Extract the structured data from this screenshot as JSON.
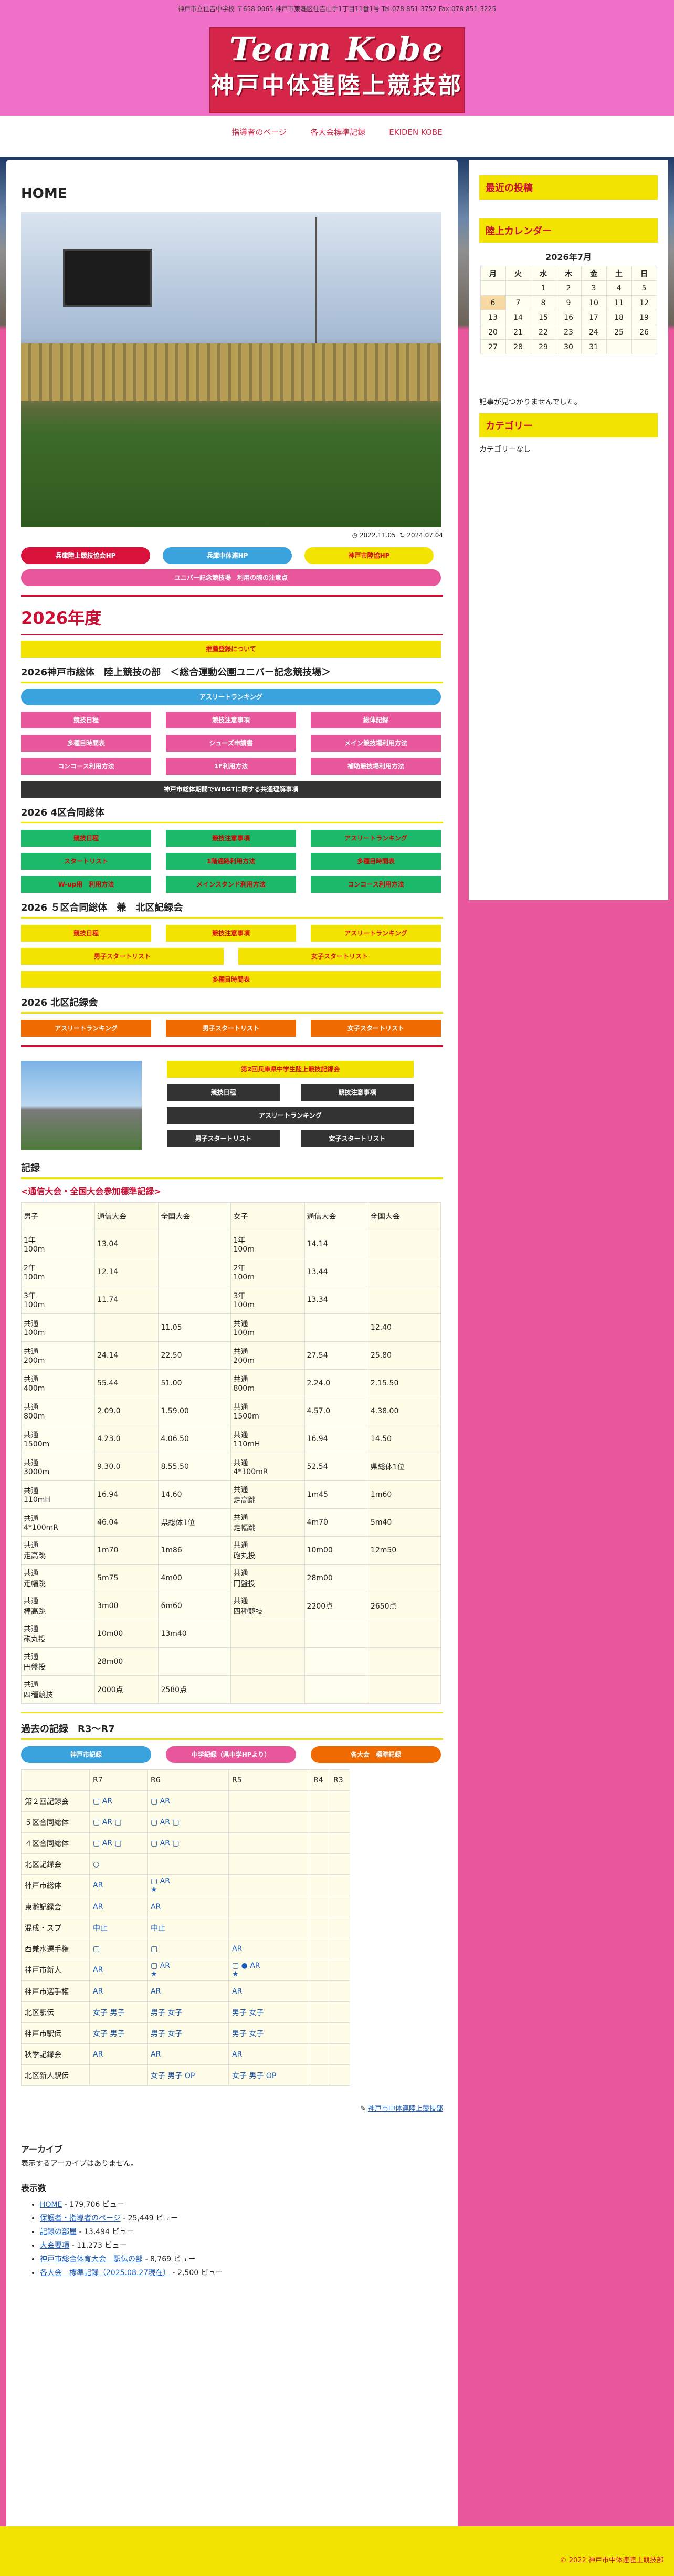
{
  "header": {
    "address": "神戸市立住吉中学校 〒658-0065 神戸市東灘区住吉山手1丁目11番1号 Tel:078-851-3752 Fax:078-851-3225",
    "logo_line1": "Team Kobe",
    "logo_line2": "神戸中体連陸上競技部"
  },
  "nav": [
    "指導者のページ",
    "各大会標準記録",
    "EKIDEN KOBE"
  ],
  "main": {
    "title": "HOME",
    "date_posted": "2022.11.05",
    "date_updated": "2024.07.04",
    "links_row1": [
      "兵庫陸上競技協会HP",
      "兵庫中体連HP",
      "神戸市陸協HP"
    ],
    "link_full": "ユニバー記念競技場　利用の際の注意点",
    "year": "2026年度",
    "yellow_bar": "推薦登録について",
    "s1_title": "2026神戸市総体　陸上競技の部　＜総合運動公園ユニバー記念競技場＞",
    "s1_full": "アスリートランキング",
    "s1_grid": [
      "競技日程",
      "競技注意事項",
      "総体記録",
      "多種目時間表",
      "シューズ申請書",
      "メイン競技場利用方法",
      "コンコース利用方法",
      "1F利用方法",
      "補助競技場利用方法"
    ],
    "s1_dark": "神戸市総体期間でWBGTに関する共通理解事項",
    "s2_title": "2026 4区合同総体",
    "s2_grid": [
      "競技日程",
      "競技注意事項",
      "アスリートランキング",
      "スタートリスト",
      "1階通路利用方法",
      "多種目時間表",
      "W-up用　利用方法",
      "メインスタンド利用方法",
      "コンコース利用方法"
    ],
    "s3_title": "2026 ５区合同総体　兼　北区記録会",
    "s3_grid": [
      "競技日程",
      "競技注意事項",
      "アスリートランキング"
    ],
    "s3_two": [
      "男子スタートリスト",
      "女子スタートリスト"
    ],
    "s3_full": "多種目時間表",
    "s4_title": "2026 北区記録会",
    "s4_grid": [
      "アスリートランキング",
      "男子スタートリスト",
      "女子スタートリスト"
    ],
    "s5_yellow": "第2回兵庫県中学生陸上競技記録会",
    "s5_btns": [
      "競技日程",
      "競技注意事項",
      "アスリートランキング",
      "男子スタートリスト",
      "女子スタートリスト"
    ],
    "rec_title": "記録",
    "rec_sub": "<通信大会・全国大会参加標準記録>",
    "rec_head": [
      "男子",
      "通信大会",
      "全国大会",
      "女子",
      "通信大会",
      "全国大会"
    ],
    "rec_rows": [
      [
        "1年\n100m",
        "13.04",
        "",
        "1年\n100m",
        "14.14",
        ""
      ],
      [
        "2年\n100m",
        "12.14",
        "",
        "2年\n100m",
        "13.44",
        ""
      ],
      [
        "3年\n100m",
        "11.74",
        "",
        "3年\n100m",
        "13.34",
        ""
      ],
      [
        "共通\n100m",
        "",
        "11.05",
        "共通\n100m",
        "",
        "12.40"
      ],
      [
        "共通\n200m",
        "24.14",
        "22.50",
        "共通\n200m",
        "27.54",
        "25.80"
      ],
      [
        "共通\n400m",
        "55.44",
        "51.00",
        "共通\n800m",
        "2.24.0",
        "2.15.50"
      ],
      [
        "共通\n800m",
        "2.09.0",
        "1.59.00",
        "共通\n1500m",
        "4.57.0",
        "4.38.00"
      ],
      [
        "共通\n1500m",
        "4.23.0",
        "4.06.50",
        "共通\n110mH",
        "16.94",
        "14.50"
      ],
      [
        "共通\n3000m",
        "9.30.0",
        "8.55.50",
        "共通\n4*100mR",
        "52.54",
        "県総体1位"
      ],
      [
        "共通\n110mH",
        "16.94",
        "14.60",
        "共通\n走高跳",
        "1m45",
        "1m60"
      ],
      [
        "共通\n4*100mR",
        "46.04",
        "県総体1位",
        "共通\n走幅跳",
        "4m70",
        "5m40"
      ],
      [
        "共通\n走高跳",
        "1m70",
        "1m86",
        "共通\n砲丸投",
        "10m00",
        "12m50"
      ],
      [
        "共通\n走幅跳",
        "5m75",
        "4m00",
        "共通\n円盤投",
        "28m00",
        ""
      ],
      [
        "共通\n棒高跳",
        "3m00",
        "6m60",
        "共通\n四種競技",
        "2200点",
        "2650点"
      ],
      [
        "共通\n砲丸投",
        "10m00",
        "13m40",
        "",
        "",
        ""
      ],
      [
        "共通\n円盤投",
        "28m00",
        "",
        "",
        "",
        ""
      ],
      [
        "共通\n四種競技",
        "2000点",
        "2580点",
        "",
        "",
        ""
      ]
    ],
    "past_title": "過去の記録　R3〜R7",
    "past_btns": [
      "神戸市記録",
      "中学記録（県中学HPより）",
      "各大会　標準記録"
    ],
    "past_head": [
      "",
      "R7",
      "R6",
      "R5",
      "R4",
      "R3"
    ],
    "past_rows": [
      [
        "第２回記録会",
        "▢ AR",
        "▢ AR",
        "",
        "",
        ""
      ],
      [
        "５区合同総体",
        "▢ AR ▢",
        "▢ AR ▢",
        "",
        "",
        ""
      ],
      [
        "４区合同総体",
        "▢ AR ▢",
        "▢ AR ▢",
        "",
        "",
        ""
      ],
      [
        "北区記録会",
        "○",
        "",
        "",
        "",
        ""
      ],
      [
        "神戸市総体",
        "AR",
        "▢ AR\n★",
        "",
        "",
        ""
      ],
      [
        "東灘記録会",
        "AR",
        "AR",
        "",
        "",
        ""
      ],
      [
        "混成・スプ",
        "中止",
        "中止",
        "",
        "",
        ""
      ],
      [
        "西兼水選手権",
        "▢",
        "▢",
        "AR",
        "",
        ""
      ],
      [
        "神戸市新人",
        "AR",
        "▢ AR\n★",
        "▢ ● AR\n★",
        "",
        ""
      ],
      [
        "神戸市選手権",
        "AR",
        "AR",
        "AR",
        "",
        ""
      ],
      [
        "北区駅伝",
        "女子 男子",
        "男子 女子",
        "男子 女子",
        "",
        ""
      ],
      [
        "神戸市駅伝",
        "女子 男子",
        "男子 女子",
        "男子 女子",
        "",
        ""
      ],
      [
        "秋季記録会",
        "AR",
        "AR",
        "AR",
        "",
        ""
      ],
      [
        "北区新人駅伝",
        "",
        "女子 男子 OP",
        "女子 男子 OP",
        "",
        ""
      ]
    ],
    "author": "神戸市中体連陸上競技部",
    "archive_title": "アーカイブ",
    "archive_text": "表示するアーカイブはありません。",
    "views_title": "表示数",
    "views": [
      {
        "link": "HOME",
        "rest": " - 179,706 ビュー"
      },
      {
        "link": "保護者・指導者のページ",
        "rest": " - 25,449 ビュー"
      },
      {
        "link": "記録の部屋",
        "rest": " - 13,494 ビュー"
      },
      {
        "link": "大会要項",
        "rest": " - 11,273 ビュー"
      },
      {
        "link": "神戸市総合体育大会　駅伝の部",
        "rest": " - 8,769 ビュー"
      },
      {
        "link": "各大会　標準記録（2025.08.27現在）",
        "rest": " - 2,500 ビュー"
      }
    ]
  },
  "side": {
    "recent": "最近の投稿",
    "calendar": "陸上カレンダー",
    "month": "2026年7月",
    "days": [
      "月",
      "火",
      "水",
      "木",
      "金",
      "土",
      "日"
    ],
    "weeks": [
      [
        "",
        "",
        "1",
        "2",
        "3",
        "4",
        "5"
      ],
      [
        "6",
        "7",
        "8",
        "9",
        "10",
        "11",
        "12"
      ],
      [
        "13",
        "14",
        "15",
        "16",
        "17",
        "18",
        "19"
      ],
      [
        "20",
        "21",
        "22",
        "23",
        "24",
        "25",
        "26"
      ],
      [
        "27",
        "28",
        "29",
        "30",
        "31",
        "",
        ""
      ]
    ],
    "no_posts": "記事が見つかりませんでした。",
    "category": "カテゴリー",
    "no_cat": "カテゴリーなし"
  },
  "footer": "© 2022 神戸市中体連陸上競技部"
}
